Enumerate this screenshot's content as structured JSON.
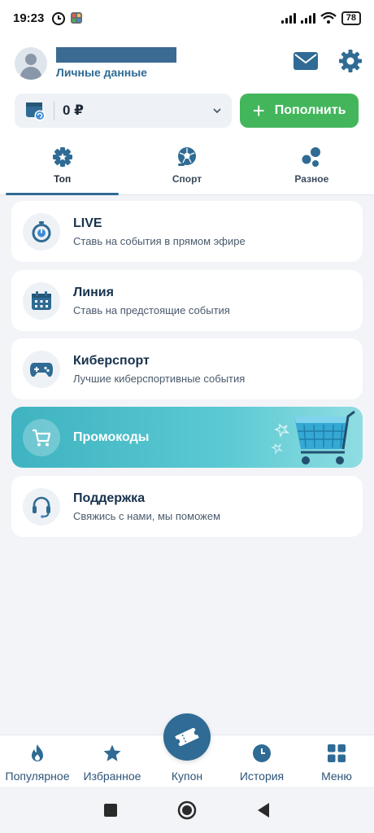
{
  "status_bar": {
    "time": "19:23",
    "battery": "78"
  },
  "header": {
    "personal_data_label": "Личные данные",
    "balance": {
      "amount": "0 ₽"
    },
    "topup_label": "Пополнить"
  },
  "tabs": [
    {
      "label": "Топ",
      "active": true
    },
    {
      "label": "Спорт",
      "active": false
    },
    {
      "label": "Разное",
      "active": false
    }
  ],
  "menu": {
    "live": {
      "title": "LIVE",
      "subtitle": "Ставь на события в прямом эфире"
    },
    "line": {
      "title": "Линия",
      "subtitle": "Ставь на предстоящие события"
    },
    "esports": {
      "title": "Киберспорт",
      "subtitle": "Лучшие киберспортивные события"
    },
    "promo": {
      "title": "Промокоды"
    },
    "support": {
      "title": "Поддержка",
      "subtitle": "Свяжись с нами, мы поможем"
    }
  },
  "bottom_nav": {
    "popular": "Популярное",
    "favorites": "Избранное",
    "coupon": "Купон",
    "history": "История",
    "menu": "Меню"
  },
  "colors": {
    "primary": "#2f6b94",
    "accent_green": "#43b65b",
    "promo_teal": "#3fb3c1",
    "background": "#f2f4f8"
  }
}
